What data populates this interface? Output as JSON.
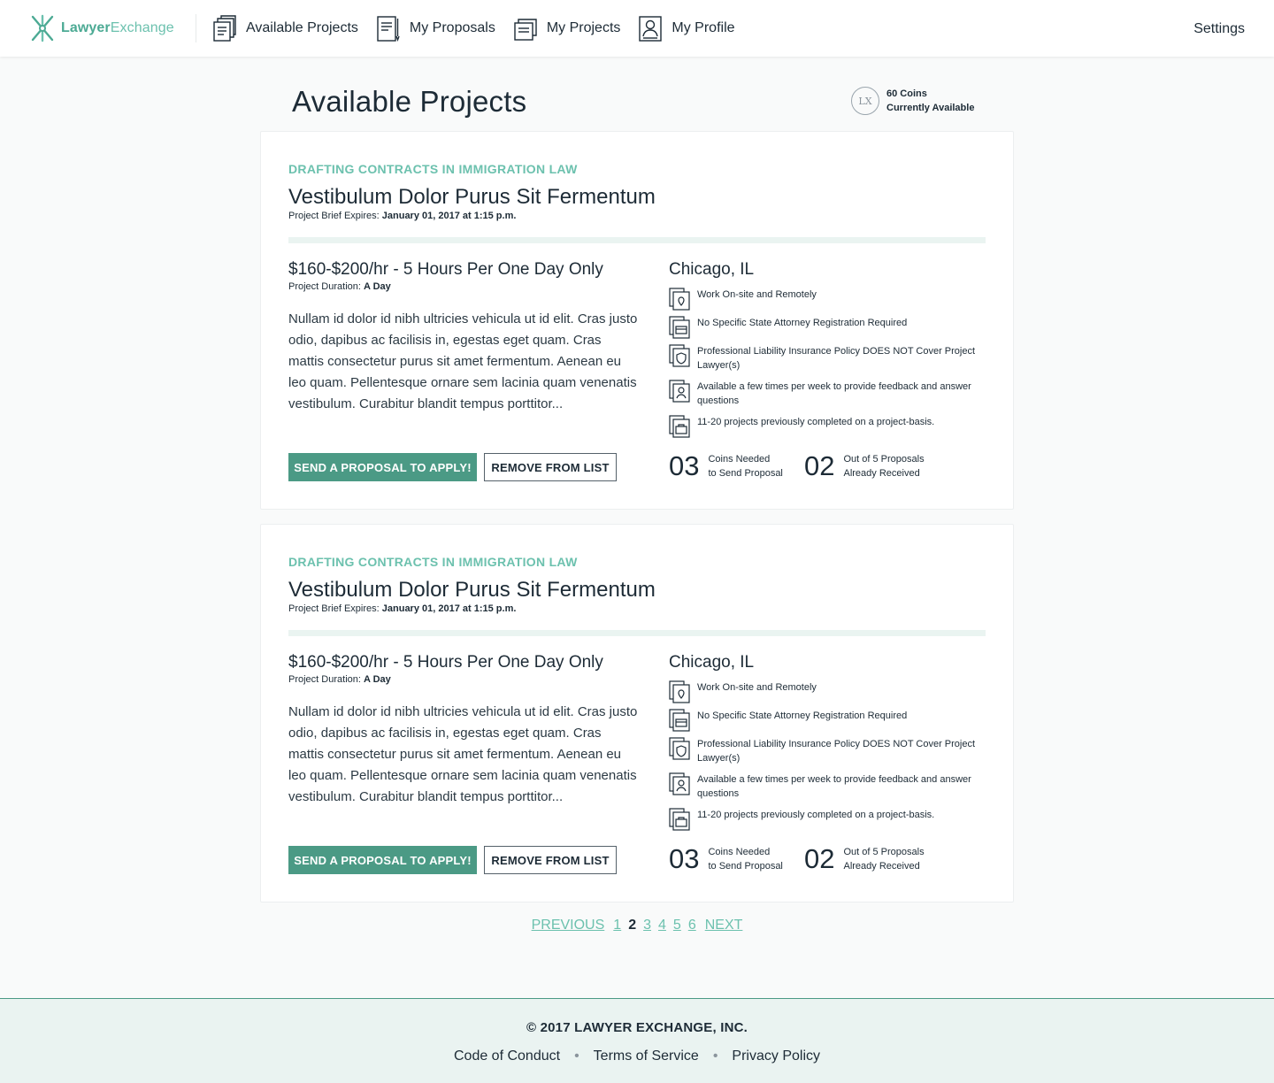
{
  "header": {
    "logo_part1": "Lawyer",
    "logo_part2": "Exchange",
    "nav": [
      {
        "label": "Available Projects",
        "icon": "documents-icon"
      },
      {
        "label": "My Proposals",
        "icon": "proposal-icon"
      },
      {
        "label": "My Projects",
        "icon": "folder-icon"
      },
      {
        "label": "My Profile",
        "icon": "profile-icon"
      }
    ],
    "settings_label": "Settings"
  },
  "page": {
    "title": "Available Projects",
    "coins_line1": "60 Coins",
    "coins_line2": "Currently Available",
    "coin_icon_text": "LX"
  },
  "projects": [
    {
      "category": "DRAFTING CONTRACTS IN IMMIGRATION LAW",
      "title": "Vestibulum Dolor Purus Sit Fermentum",
      "expires_label": "Project Brief Expires:",
      "expires_value": "January 01, 2017 at 1:15 p.m.",
      "rate": "$160-$200/hr - 5 Hours Per One Day Only",
      "duration_label": "Project Duration:",
      "duration_value": "A Day",
      "description": "Nullam id dolor id nibh ultricies vehicula ut id elit. Cras justo odio, dapibus ac facilisis in, egestas eget quam. Cras mattis consectetur purus sit amet fermentum. Aenean eu leo quam. Pellentesque ornare sem lacinia quam venenatis vestibulum. Curabitur blandit tempus porttitor...",
      "send_label": "SEND A PROPOSAL TO APPLY!",
      "remove_label": "REMOVE FROM LIST",
      "city": "Chicago, IL",
      "features": [
        "Work On-site and Remotely",
        "No Specific State Attorney Registration Required",
        "Professional Liability Insurance Policy DOES NOT Cover Project Lawyer(s)",
        "Available a few times per week to provide feedback and answer questions",
        "11-20 projects previously completed on a project-basis."
      ],
      "coins_needed": "03",
      "coins_needed_l1": "Coins Needed",
      "coins_needed_l2": "to Send Proposal",
      "proposals_received": "02",
      "proposals_l1": "Out of 5 Proposals",
      "proposals_l2": "Already Received"
    },
    {
      "category": "DRAFTING CONTRACTS IN IMMIGRATION LAW",
      "title": "Vestibulum Dolor Purus Sit Fermentum",
      "expires_label": "Project Brief Expires:",
      "expires_value": "January 01, 2017 at 1:15 p.m.",
      "rate": "$160-$200/hr - 5 Hours Per One Day Only",
      "duration_label": "Project Duration:",
      "duration_value": "A Day",
      "description": "Nullam id dolor id nibh ultricies vehicula ut id elit. Cras justo odio, dapibus ac facilisis in, egestas eget quam. Cras mattis consectetur purus sit amet fermentum. Aenean eu leo quam. Pellentesque ornare sem lacinia quam venenatis vestibulum. Curabitur blandit tempus porttitor...",
      "send_label": "SEND A PROPOSAL TO APPLY!",
      "remove_label": "REMOVE FROM LIST",
      "city": "Chicago, IL",
      "features": [
        "Work On-site and Remotely",
        "No Specific State Attorney Registration Required",
        "Professional Liability Insurance Policy DOES NOT Cover Project Lawyer(s)",
        "Available a few times per week to provide feedback and answer questions",
        "11-20 projects previously completed on a project-basis."
      ],
      "coins_needed": "03",
      "coins_needed_l1": "Coins Needed",
      "coins_needed_l2": "to Send Proposal",
      "proposals_received": "02",
      "proposals_l1": "Out of 5 Proposals",
      "proposals_l2": "Already Received"
    }
  ],
  "pagination": {
    "previous": "PREVIOUS",
    "pages": [
      "1",
      "2",
      "3",
      "4",
      "5",
      "6"
    ],
    "current": "2",
    "next": "NEXT"
  },
  "footer": {
    "copyright": "© 2017 LAWYER EXCHANGE, INC.",
    "links": [
      "Code of Conduct",
      "Terms of Service",
      "Privacy Policy"
    ],
    "separator": "•"
  },
  "colors": {
    "brand": "#4caa94",
    "brand_light": "#6cc1ae",
    "button": "#4b9a85",
    "text": "#1d2b36",
    "footer_bg": "#eaf3f1"
  }
}
